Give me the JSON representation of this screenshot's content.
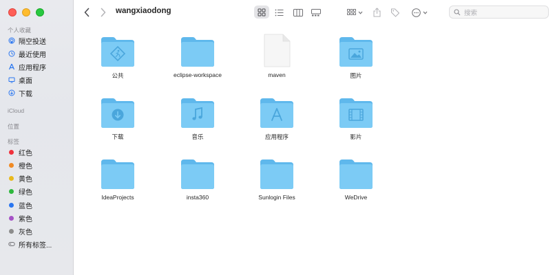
{
  "window": {
    "title": "wangxiaodong"
  },
  "sidebar": {
    "favorites_title": "个人收藏",
    "favorites": [
      {
        "label": "隔空投送",
        "icon": "airdrop-icon"
      },
      {
        "label": "最近使用",
        "icon": "clock-icon"
      },
      {
        "label": "应用程序",
        "icon": "applications-icon"
      },
      {
        "label": "桌面",
        "icon": "desktop-icon"
      },
      {
        "label": "下载",
        "icon": "download-icon"
      }
    ],
    "icloud_title": "iCloud",
    "locations_title": "位置",
    "tags_title": "标签",
    "tags": [
      {
        "label": "红色",
        "color": "#f0313c"
      },
      {
        "label": "橙色",
        "color": "#f08a24"
      },
      {
        "label": "黄色",
        "color": "#e9b91c"
      },
      {
        "label": "绿色",
        "color": "#2eb83d"
      },
      {
        "label": "蓝色",
        "color": "#2a76f0"
      },
      {
        "label": "紫色",
        "color": "#a552c6"
      },
      {
        "label": "灰色",
        "color": "#8c8c8c"
      }
    ],
    "all_tags": "所有标签..."
  },
  "toolbar": {
    "search_placeholder": "搜索"
  },
  "files": [
    {
      "label": "公共",
      "type": "public-folder"
    },
    {
      "label": "eclipse-workspace",
      "type": "folder"
    },
    {
      "label": "maven",
      "type": "document"
    },
    {
      "label": "图片",
      "type": "pictures-folder"
    },
    {
      "label": "下载",
      "type": "downloads-folder"
    },
    {
      "label": "音乐",
      "type": "music-folder"
    },
    {
      "label": "应用程序",
      "type": "applications-folder"
    },
    {
      "label": "影片",
      "type": "movies-folder"
    },
    {
      "label": "IdeaProjects",
      "type": "folder"
    },
    {
      "label": "insta360",
      "type": "folder"
    },
    {
      "label": "Sunlogin Files",
      "type": "folder"
    },
    {
      "label": "WeDrive",
      "type": "folder"
    }
  ],
  "colors": {
    "folder_back": "#5fb8ec",
    "folder_front": "#7ccbf5",
    "folder_glyph": "#4aa6dc",
    "accent": "#2a76f0"
  }
}
